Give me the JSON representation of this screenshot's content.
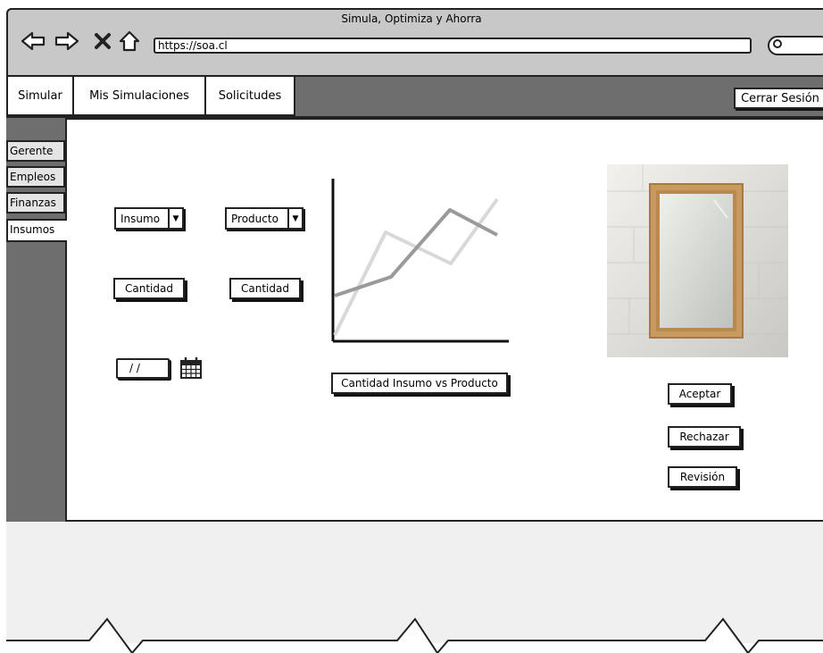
{
  "window": {
    "title": "Simula, Optimiza y Ahorra",
    "url": "https://soa.cl"
  },
  "nav_icons": {
    "back": "left-arrow-icon",
    "forward": "right-arrow-icon",
    "stop": "close-icon",
    "home": "home-icon",
    "search": "search-icon"
  },
  "top_nav": {
    "tabs": [
      {
        "label": "Simular"
      },
      {
        "label": "Mis Simulaciones"
      },
      {
        "label": "Solicitudes"
      }
    ],
    "logout_label": "Cerrar Sesión"
  },
  "sidebar": {
    "items": [
      {
        "label": "Gerente"
      },
      {
        "label": "Empleos"
      },
      {
        "label": "Finanzas"
      },
      {
        "label": "Insumos"
      }
    ],
    "selected": "Insumos"
  },
  "form": {
    "insumo_select": "Insumo",
    "producto_select": "Producto",
    "cantidad_left": "Cantidad",
    "cantidad_right": "Cantidad",
    "date_value": "/ /"
  },
  "chart": {
    "caption": "Cantidad Insumo vs Producto"
  },
  "actions": {
    "accept": "Aceptar",
    "reject": "Rechazar",
    "review": "Revisión"
  },
  "colors": {
    "toolbar": "#c8c8c8",
    "nav_dark": "#6e6e6e",
    "frame_bg": "#f0f0f0",
    "mirror_frame": "#c9995f"
  }
}
